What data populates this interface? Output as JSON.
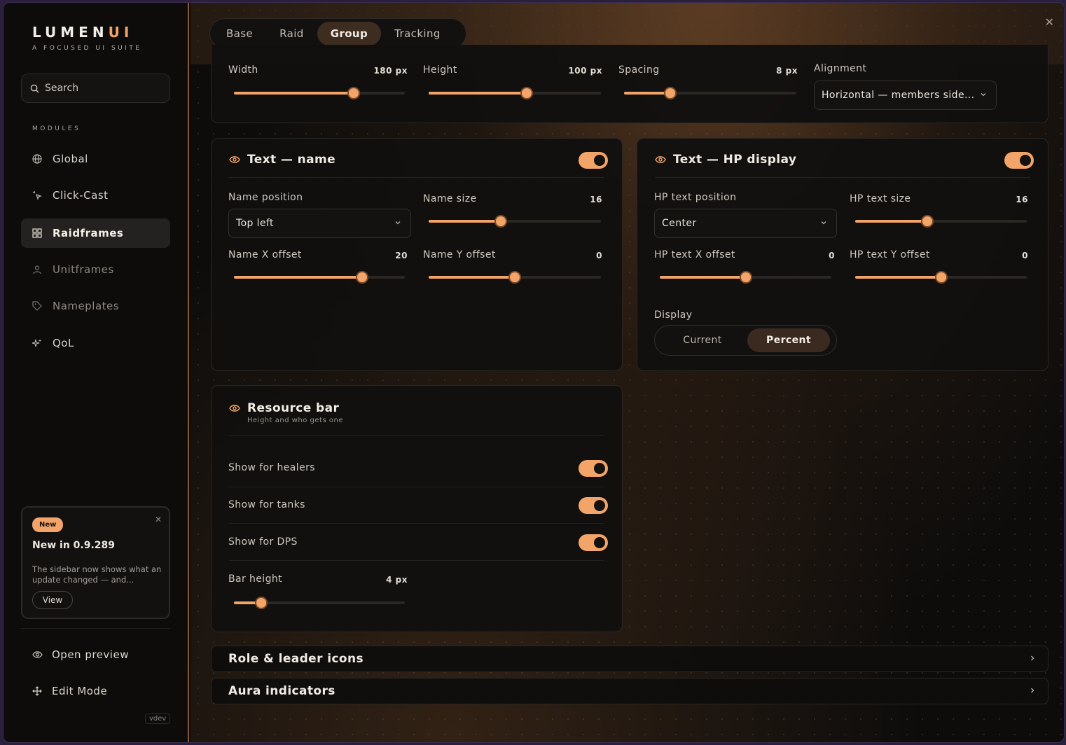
{
  "app": {
    "logo_main": "LUMEN",
    "logo_accent": "UI",
    "tagline": "A FOCUSED UI SUITE"
  },
  "sidebar": {
    "search_placeholder": "Search",
    "modules_label": "MODULES",
    "items": [
      {
        "label": "Global",
        "icon": "globe-icon"
      },
      {
        "label": "Click-Cast",
        "icon": "sparkle-click-icon"
      },
      {
        "label": "Raidframes",
        "icon": "grid-icon",
        "active": true
      },
      {
        "label": "Unitframes",
        "icon": "user-icon"
      },
      {
        "label": "Nameplates",
        "icon": "tag-icon"
      },
      {
        "label": "QoL",
        "icon": "sparkles-icon"
      }
    ],
    "news": {
      "badge": "New",
      "title": "New in 0.9.289",
      "body": "The sidebar now shows what an update changed — and...",
      "view_label": "View"
    },
    "open_preview": "Open preview",
    "edit_mode": "Edit Mode",
    "version": "vdev"
  },
  "tabs": [
    "Base",
    "Raid",
    "Group",
    "Tracking"
  ],
  "active_tab": "Group",
  "layout_card": {
    "width": {
      "label": "Width",
      "value": "180 px",
      "fraction": 0.7
    },
    "height": {
      "label": "Height",
      "value": "100 px",
      "fraction": 0.57
    },
    "spacing": {
      "label": "Spacing",
      "value": "8 px",
      "fraction": 0.27
    },
    "alignment": {
      "label": "Alignment",
      "value": "Horizontal — members side..."
    }
  },
  "text_name": {
    "title": "Text — name",
    "position": {
      "label": "Name position",
      "value": "Top left"
    },
    "size": {
      "label": "Name size",
      "value": "16",
      "fraction": 0.42
    },
    "x_offset": {
      "label": "Name X offset",
      "value": "20",
      "fraction": 0.75
    },
    "y_offset": {
      "label": "Name Y offset",
      "value": "0",
      "fraction": 0.5
    }
  },
  "text_hp": {
    "title": "Text — HP display",
    "position": {
      "label": "HP text position",
      "value": "Center"
    },
    "size": {
      "label": "HP text size",
      "value": "16",
      "fraction": 0.42
    },
    "x_offset": {
      "label": "HP text X offset",
      "value": "0",
      "fraction": 0.5
    },
    "y_offset": {
      "label": "HP text Y offset",
      "value": "0",
      "fraction": 0.5
    },
    "display": {
      "label": "Display",
      "options": [
        "Current",
        "Percent"
      ],
      "selected": "Percent"
    }
  },
  "resource_bar": {
    "title": "Resource bar",
    "subtitle": "Height and who gets one",
    "healers": "Show for healers",
    "tanks": "Show for tanks",
    "dps": "Show for DPS",
    "bar_height": {
      "label": "Bar height",
      "value": "4 px",
      "fraction": 0.16
    }
  },
  "sections": [
    "Role & leader icons",
    "Aura indicators"
  ],
  "colors": {
    "accent": "#f3a468",
    "background": "#0c0b0a",
    "window_border": "#3a2d4d"
  }
}
